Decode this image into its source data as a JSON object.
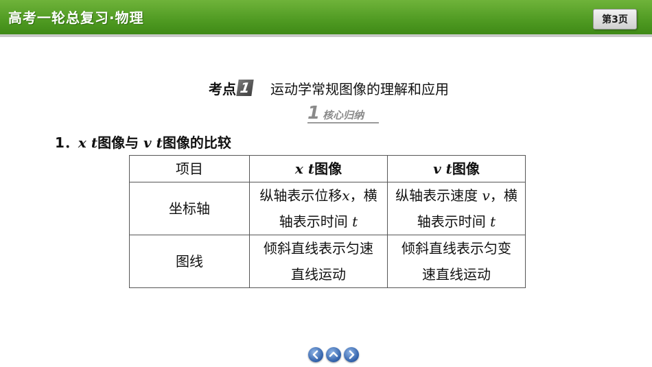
{
  "header": {
    "course_title": "高考一轮总复习·物理",
    "page_badge": "第3页",
    "bar_color": "#4f9a22"
  },
  "kaodian": {
    "label": "考点",
    "number": "1",
    "title": "运动学常规图像的理解和应用"
  },
  "core": {
    "number": "1",
    "text": "核心归纳"
  },
  "section": {
    "num": "1．",
    "a": "x",
    "b": "t",
    "mid": "图像与",
    "c": "v",
    "d": "t",
    "tail": "图像的比较"
  },
  "table": {
    "header": {
      "c1": "项目",
      "c2": {
        "a": "x",
        "b": "t",
        "text": "图像"
      },
      "c3": {
        "a": "v",
        "b": "t",
        "text": "图像"
      }
    },
    "row1": {
      "label": "坐标轴",
      "c2": {
        "l1a": "纵轴表示位移",
        "l1v": "x",
        "l1b": "，横",
        "l2a": "轴表示时间",
        "l2v": "t"
      },
      "c3": {
        "l1a": "纵轴表示速度",
        "l1v": "v",
        "l1b": "，横",
        "l2a": "轴表示时间",
        "l2v": "t"
      }
    },
    "row2": {
      "label": "图线",
      "c2": {
        "l1": "倾斜直线表示匀速",
        "l2": "直线运动"
      },
      "c3": {
        "l1": "倾斜直线表示匀变",
        "l2": "速直线运动"
      }
    }
  },
  "nav": {
    "icons": [
      "prev-arrow-icon",
      "home-up-arrow-icon",
      "next-arrow-icon"
    ]
  }
}
